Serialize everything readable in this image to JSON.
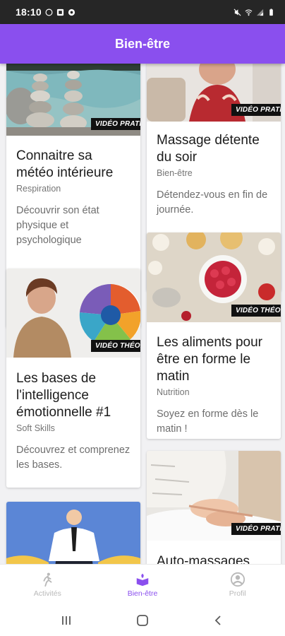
{
  "status_bar": {
    "time": "18:10"
  },
  "app_bar": {
    "title": "Bien-être"
  },
  "cards": [
    {
      "title": "Connaitre sa météo intérieure",
      "category": "Respiration",
      "description": "Découvrir son état physique et psychologique",
      "badge": "VIDÉO PRATIQUE"
    },
    {
      "title": "Massage détente du soir",
      "category": "Bien-être",
      "description": "Détendez-vous en fin de journée.",
      "badge": "VIDÉO PRATIQUE"
    },
    {
      "title": "Les bases de l'intelligence émotionnelle #1",
      "category": "Soft Skills",
      "description": "Découvrez et comprenez les bases.",
      "badge": "VIDÉO THÉORIQUE"
    },
    {
      "title": "Les aliments pour être en forme le matin",
      "category": "Nutrition",
      "description": "Soyez en forme dès le matin !",
      "badge": "VIDÉO THÉORIQUE"
    },
    {
      "title": "",
      "category": "",
      "description": "",
      "badge": ""
    },
    {
      "title": "Auto-massages",
      "category": "",
      "description": "",
      "badge": "VIDÉO PRATIQUE"
    }
  ],
  "bottom_nav": [
    {
      "label": "Activités",
      "icon": "runner-icon",
      "active": false
    },
    {
      "label": "Bien-être",
      "icon": "wellbeing-icon",
      "active": true
    },
    {
      "label": "Profil",
      "icon": "profile-icon",
      "active": false
    }
  ],
  "colors": {
    "primary": "#8a4fee",
    "inactive": "#b9b9b9"
  }
}
